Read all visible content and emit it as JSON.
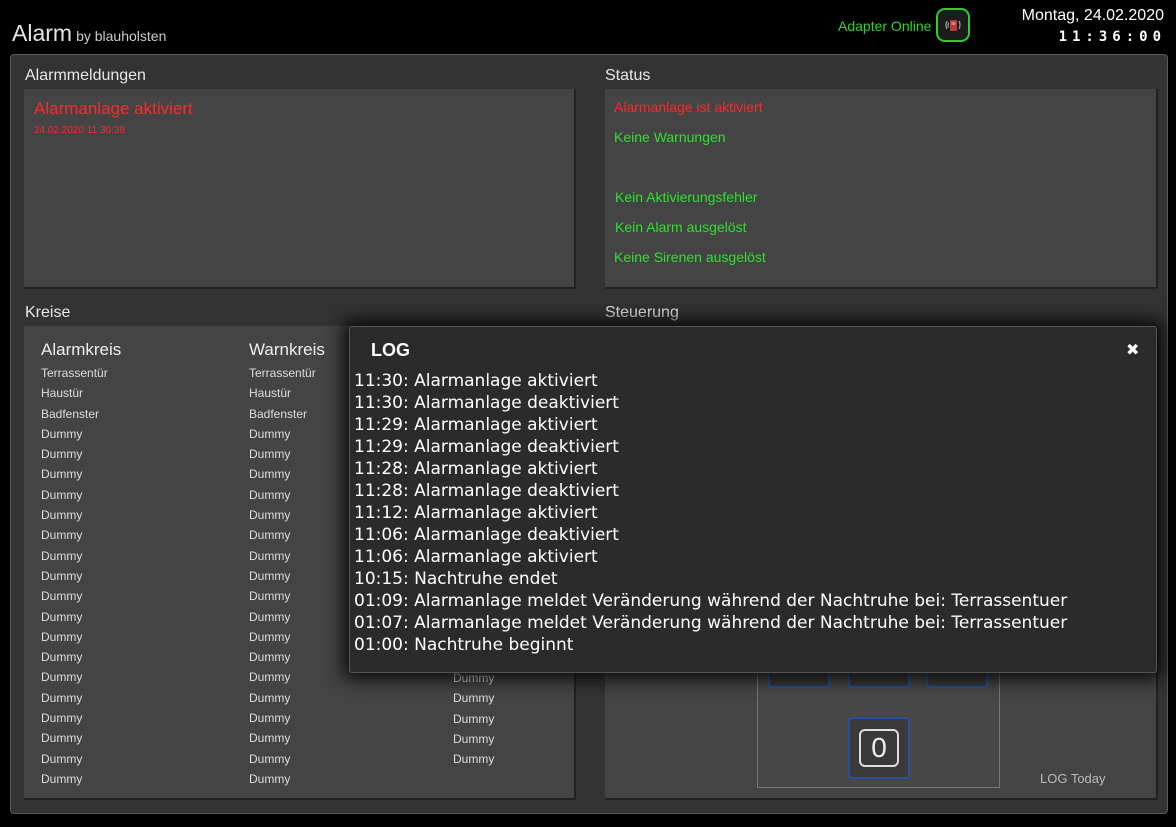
{
  "header": {
    "app_name": "Alarm",
    "app_by": "by blauholsten",
    "adapter_status": "Adapter Online",
    "adapter_icon": "phone-signal-icon",
    "date": "Montag, 24.02.2020",
    "clock": "11:36:00"
  },
  "alarmmeldungen": {
    "title": "Alarmmeldungen",
    "message": "Alarmanlage aktiviert",
    "timestamp": "24.02.2020 11:30:38"
  },
  "status": {
    "title": "Status",
    "lines": [
      {
        "text": "Alarmanlage ist aktiviert",
        "color": "#ff2a2a"
      },
      {
        "text": "Keine Warnungen",
        "color": "#2fe02f"
      },
      {
        "text": "Kein Aktivierungsfehler",
        "color": "#2fe02f"
      },
      {
        "text": "Kein Alarm ausgelöst",
        "color": "#2fe02f"
      },
      {
        "text": "Keine Sirenen ausgelöst",
        "color": "#2fe02f"
      }
    ]
  },
  "kreise": {
    "title": "Kreise",
    "col1_title": "Alarmkreis",
    "col2_title": "Warnkreis",
    "col1": [
      "Terrassentür",
      "Haustür",
      "Badfenster",
      "Dummy",
      "Dummy",
      "Dummy",
      "Dummy",
      "Dummy",
      "Dummy",
      "Dummy",
      "Dummy",
      "Dummy",
      "Dummy",
      "Dummy",
      "Dummy",
      "Dummy",
      "Dummy",
      "Dummy",
      "Dummy",
      "Dummy",
      "Dummy"
    ],
    "col2": [
      "Terrassentür",
      "Haustür",
      "Badfenster",
      "Dummy",
      "Dummy",
      "Dummy",
      "Dummy",
      "Dummy",
      "Dummy",
      "Dummy",
      "Dummy",
      "Dummy",
      "Dummy",
      "Dummy",
      "Dummy",
      "Dummy",
      "Dummy",
      "Dummy",
      "Dummy",
      "Dummy",
      "Dummy"
    ],
    "col3": [
      "Dummy",
      "Dummy",
      "Dummy",
      "Dummy",
      "Dummy"
    ]
  },
  "steuerung": {
    "title": "Steuerung",
    "key_zero": "0",
    "log_today": "LOG Today"
  },
  "log": {
    "title": "LOG",
    "close": "✖",
    "entries": [
      "11:30: Alarmanlage aktiviert",
      "11:30: Alarmanlage deaktiviert",
      "11:29: Alarmanlage aktiviert",
      "11:29: Alarmanlage deaktiviert",
      "11:28: Alarmanlage aktiviert",
      "11:28: Alarmanlage deaktiviert",
      "11:12: Alarmanlage aktiviert",
      "11:06: Alarmanlage deaktiviert",
      "11:06: Alarmanlage aktiviert",
      "10:15: Nachtruhe endet",
      "01:09: Alarmanlage meldet Veränderung während der Nachtruhe bei: Terrassentuer",
      "01:07: Alarmanlage meldet Veränderung während der Nachtruhe bei: Terrassentuer",
      "01:00: Nachtruhe beginnt"
    ]
  }
}
